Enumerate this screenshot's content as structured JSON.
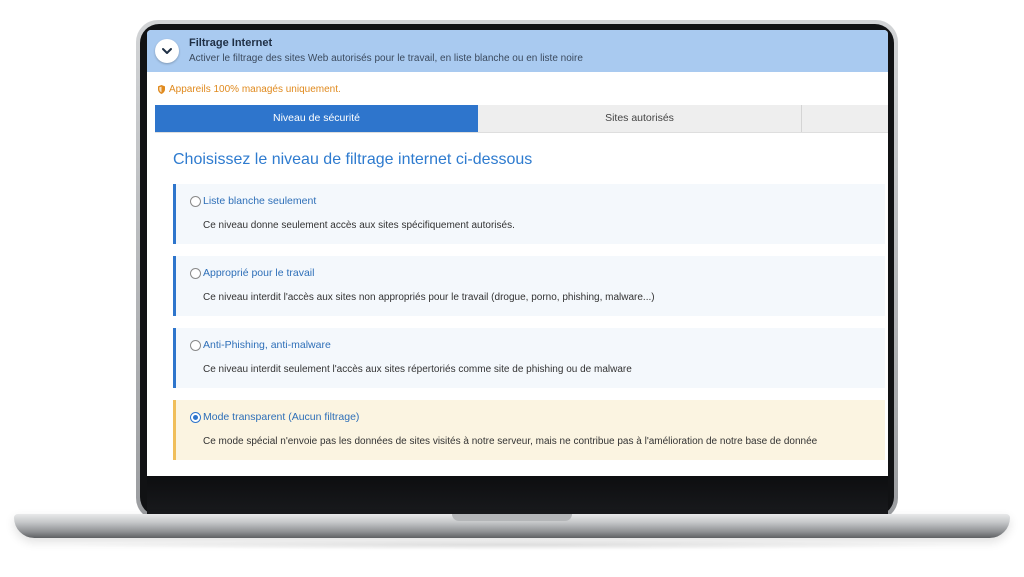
{
  "header": {
    "title": "Filtrage Internet",
    "subtitle": "Activer le filtrage des sites Web autorisés pour le travail, en liste blanche ou en liste noire",
    "toggle_icon": "chevron-down-icon"
  },
  "notice": {
    "icon": "shield-icon",
    "text": "Appareils 100% managés uniquement."
  },
  "tabs": [
    {
      "label": "Niveau de sécurité",
      "active": true
    },
    {
      "label": "Sites autorisés",
      "active": false
    },
    {
      "label": "",
      "active": false
    }
  ],
  "main": {
    "title": "Choisissez le niveau de filtrage internet ci-dessous",
    "options": [
      {
        "label": "Liste blanche seulement",
        "description": "Ce niveau donne seulement accès aux sites spécifiquement autorisés.",
        "selected": false
      },
      {
        "label": "Approprié pour le travail",
        "description": "Ce niveau interdit l'accès aux sites non appropriés pour le travail (drogue, porno, phishing, malware...)",
        "selected": false
      },
      {
        "label": "Anti-Phishing, anti-malware",
        "description": "Ce niveau interdit seulement l'accès aux sites répertoriés comme site de phishing ou de malware",
        "selected": false
      },
      {
        "label": "Mode transparent (Aucun filtrage)",
        "description": "Ce mode spécial n'envoie pas les données de sites visités à notre serveur, mais ne contribue pas à l'amélioration de notre base de donnée",
        "selected": true
      }
    ]
  },
  "colors": {
    "header_bg": "#a9caf0",
    "accent": "#2e75cc",
    "notice": "#e08a1e",
    "selected_bg": "#fbf4e1",
    "selected_border": "#f0be5a"
  }
}
